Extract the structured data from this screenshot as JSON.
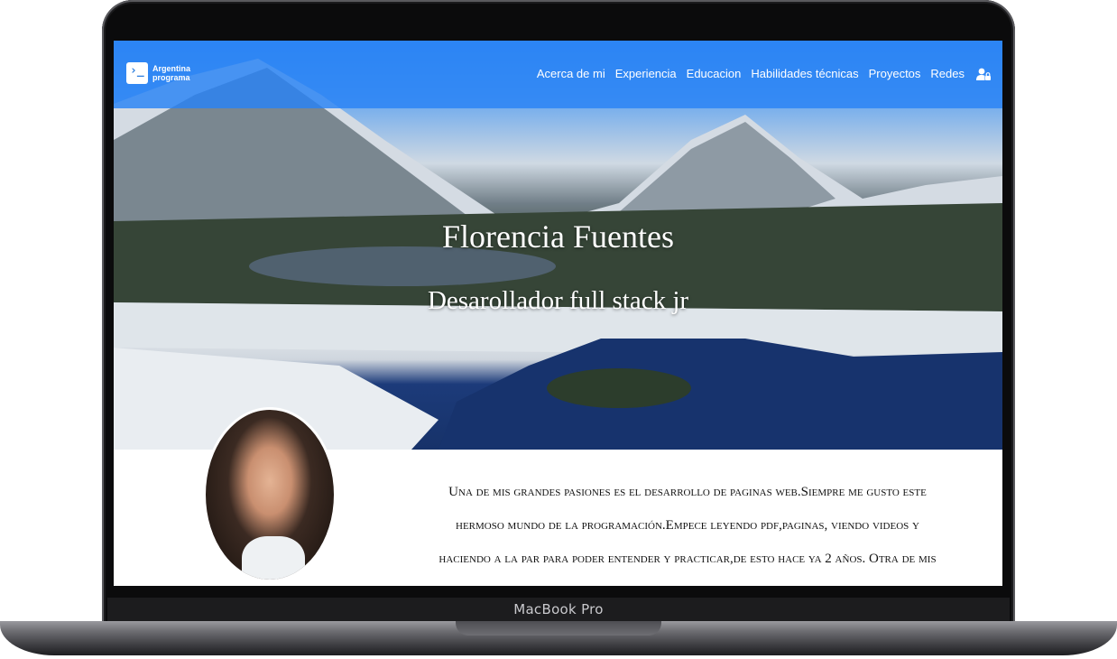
{
  "device": {
    "brand_label": "MacBook Pro"
  },
  "navbar": {
    "logo_text": "Argentina programa",
    "links": [
      "Acerca de mi",
      "Experiencia",
      "Educacion",
      "Habilidades técnicas",
      "Proyectos",
      "Redes"
    ],
    "login_icon": "user-lock-icon"
  },
  "hero": {
    "name": "Florencia Fuentes",
    "role": "Desarollador full stack jr"
  },
  "about": {
    "text": "Una de mis grandes pasiones es el desarrollo de paginas web.Siempre me gusto este hermoso mundo de la programación.Empece leyendo pdf,paginas, viendo videos y haciendo a la par para poder entender y practicar,de esto hace ya 2 años. Otra de mis"
  },
  "colors": {
    "navbar": "#2882f5",
    "accent_text": "#ffffff"
  }
}
